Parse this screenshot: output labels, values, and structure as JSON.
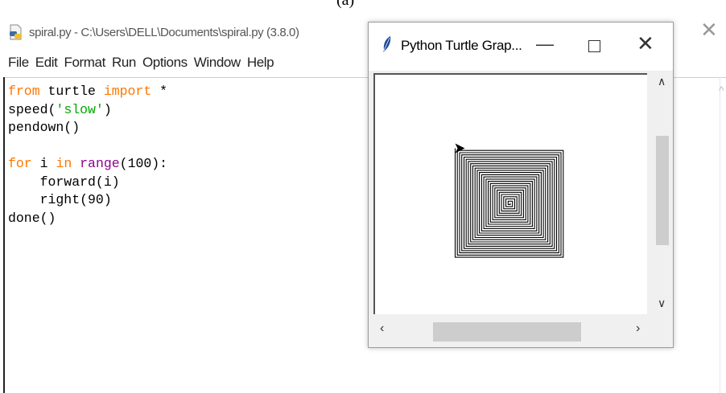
{
  "caption_fragment": "(a)",
  "editor": {
    "title": "spiral.py - C:\\Users\\DELL\\Documents\\spiral.py (3.8.0)",
    "menu": [
      "File",
      "Edit",
      "Format",
      "Run",
      "Options",
      "Window",
      "Help"
    ],
    "code_lines": [
      [
        {
          "t": "from",
          "c": "kw-orange"
        },
        {
          "t": " turtle "
        },
        {
          "t": "import",
          "c": "kw-orange"
        },
        {
          "t": " *"
        }
      ],
      [
        {
          "t": "speed("
        },
        {
          "t": "'slow'",
          "c": "str-green"
        },
        {
          "t": ")"
        }
      ],
      [
        {
          "t": "pendown()"
        }
      ],
      [
        {
          "t": ""
        }
      ],
      [
        {
          "t": "for",
          "c": "kw-orange"
        },
        {
          "t": " i "
        },
        {
          "t": "in",
          "c": "kw-orange"
        },
        {
          "t": " "
        },
        {
          "t": "range",
          "c": "kw-purple"
        },
        {
          "t": "(100):"
        }
      ],
      [
        {
          "t": "    forward(i)"
        }
      ],
      [
        {
          "t": "    right(90)"
        }
      ],
      [
        {
          "t": "done()"
        }
      ]
    ]
  },
  "turtle_window": {
    "title": "Python Turtle Grap...",
    "spiral": {
      "steps": 100,
      "turn_degrees": 90
    }
  },
  "icons": {
    "file": "python-file-icon",
    "feather": "feather-icon",
    "turtle": "turtle-arrow-icon"
  }
}
